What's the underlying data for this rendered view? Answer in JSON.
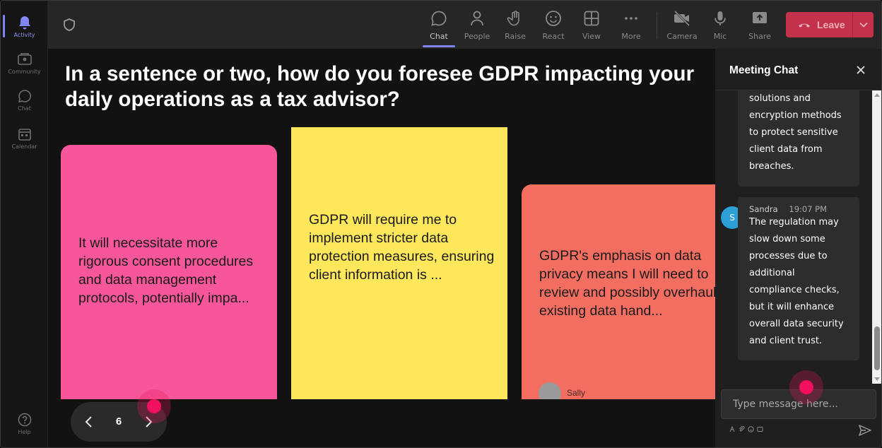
{
  "rail": {
    "items": [
      {
        "label": "Activity",
        "icon": "bell-icon",
        "active": true
      },
      {
        "label": "Community",
        "icon": "community-icon"
      },
      {
        "label": "Chat",
        "icon": "chat-icon"
      },
      {
        "label": "Calendar",
        "icon": "calendar-icon"
      }
    ],
    "help_label": "Help"
  },
  "toolbar": {
    "buttons": [
      {
        "label": "Chat",
        "icon": "chat-icon",
        "active": true
      },
      {
        "label": "People",
        "icon": "people-icon"
      },
      {
        "label": "Raise",
        "icon": "hand-icon"
      },
      {
        "label": "React",
        "icon": "smiley-icon"
      },
      {
        "label": "View",
        "icon": "grid-icon"
      },
      {
        "label": "More",
        "icon": "more-dots-icon"
      },
      {
        "label": "Camera",
        "icon": "camera-off-icon"
      },
      {
        "label": "Mic",
        "icon": "mic-icon"
      },
      {
        "label": "Share",
        "icon": "share-icon"
      }
    ],
    "leave_label": "Leave",
    "leave_color": "#c4314b"
  },
  "stage": {
    "question": "In a sentence or two, how do you foresee GDPR impacting your daily operations as a tax advisor?",
    "cards": [
      {
        "text": "It will necessitate more rigorous consent procedures and data management protocols, potentially impa...",
        "color": "#f7569a"
      },
      {
        "text": "GDPR will require me to implement stricter data protection measures, ensuring client information is ...",
        "color": "#fee75b"
      },
      {
        "lines": [
          "GDPR's emphasis on data",
          "privacy means I will need to",
          "review and possibly overhaul",
          "existing data hand..."
        ],
        "color": "#f36e60",
        "author_initial": "S",
        "author_name": "Sally"
      }
    ],
    "pager": {
      "page": "6"
    }
  },
  "chat": {
    "title": "Meeting Chat",
    "messages": [
      {
        "body": [
          "solutions and",
          "encryption methods",
          "to protect sensitive",
          "client data from",
          "breaches."
        ]
      },
      {
        "sender": "Sandra",
        "avatar_initial": "S",
        "time": "19:07 PM",
        "body": [
          "The regulation may",
          "slow down some",
          "processes due to",
          "additional",
          "compliance checks,",
          "but it will enhance",
          "overall data security",
          "and client trust."
        ]
      }
    ],
    "compose_placeholder": "Type message here...",
    "accent": "#7f85f5"
  }
}
